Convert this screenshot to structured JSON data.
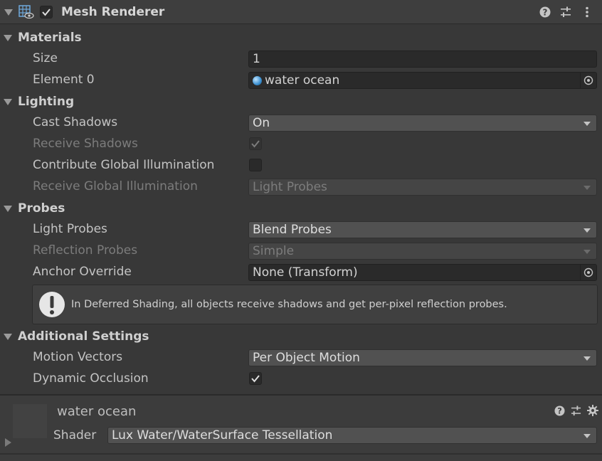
{
  "component": {
    "title": "Mesh Renderer",
    "enabled": true,
    "icon": "mesh-renderer-icon",
    "header_icons": [
      "help-icon",
      "preset-icon",
      "kebab-menu-icon"
    ]
  },
  "sections": {
    "materials": {
      "label": "Materials",
      "size_label": "Size",
      "size_value": "1",
      "element_label": "Element 0",
      "element_value": "water ocean"
    },
    "lighting": {
      "label": "Lighting",
      "cast_shadows_label": "Cast Shadows",
      "cast_shadows_value": "On",
      "receive_shadows_label": "Receive Shadows",
      "receive_shadows_checked": true,
      "contribute_gi_label": "Contribute Global Illumination",
      "contribute_gi_checked": false,
      "receive_gi_label": "Receive Global Illumination",
      "receive_gi_value": "Light Probes"
    },
    "probes": {
      "label": "Probes",
      "light_probes_label": "Light Probes",
      "light_probes_value": "Blend Probes",
      "reflection_probes_label": "Reflection Probes",
      "reflection_probes_value": "Simple",
      "anchor_label": "Anchor Override",
      "anchor_value": "None (Transform)",
      "info_text": "In Deferred Shading, all objects receive shadows and get per-pixel reflection probes."
    },
    "additional": {
      "label": "Additional Settings",
      "motion_vectors_label": "Motion Vectors",
      "motion_vectors_value": "Per Object Motion",
      "dynamic_occlusion_label": "Dynamic Occlusion",
      "dynamic_occlusion_checked": true
    }
  },
  "material": {
    "name": "water ocean",
    "shader_label": "Shader",
    "shader_value": "Lux Water/WaterSurface Tessellation"
  },
  "colors": {
    "background": "#383838",
    "field": "#2a2a2a",
    "dropdown": "#515151",
    "object_dot": "#4aa3df"
  }
}
